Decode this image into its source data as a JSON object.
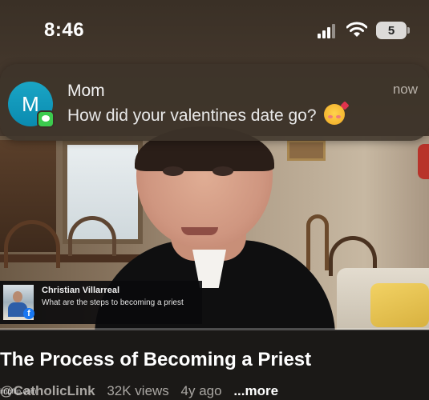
{
  "status_bar": {
    "time": "8:46",
    "battery_level": "5",
    "icons": [
      "signal-icon",
      "wifi-icon",
      "battery-icon"
    ]
  },
  "notification": {
    "avatar_initial": "M",
    "app_badge_icon": "messages-icon",
    "sender": "Mom",
    "message": "How did your valentines date go?",
    "emoji_icon": "smiling-face-with-hearts-icon",
    "time": "now"
  },
  "caption_card": {
    "name": "Christian Villarreal",
    "question": "What are the steps to becoming a priest",
    "platform_icon": "facebook-icon",
    "platform_glyph": "f"
  },
  "video": {
    "progress": 0.0,
    "title": "The Process of Becoming a Priest",
    "channel": "@CatholicLink",
    "views": "32K views",
    "age": "4y ago",
    "more_label": "...more"
  },
  "watermark": "imgflip.com",
  "colors": {
    "progress": "#ff0000",
    "avatar": "#0a8bb0",
    "messages_badge": "#3ccb4e",
    "facebook": "#1877f2"
  }
}
